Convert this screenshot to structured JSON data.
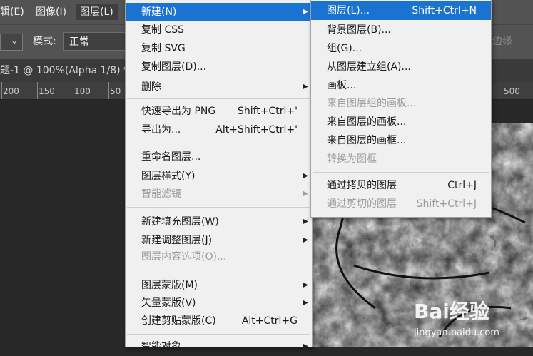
{
  "menubar": {
    "items": [
      "辑(E)",
      "图像(I)",
      "图层(L)"
    ]
  },
  "options": {
    "mode_label": "模式:",
    "mode_value": "正常",
    "edge_label": "边缘"
  },
  "doc_tab": {
    "title": "题-1 @ 100%(Alpha 1/8) *"
  },
  "ruler": {
    "ticks": [
      "200",
      "150",
      "100",
      "50",
      "500"
    ]
  },
  "layer_menu": {
    "items": [
      {
        "label": "新建(N)",
        "shortcut": "",
        "submenu": true,
        "disabled": false,
        "highlight": true
      },
      {
        "label": "复制 CSS",
        "shortcut": "",
        "submenu": false,
        "disabled": false
      },
      {
        "label": "复制 SVG",
        "shortcut": "",
        "submenu": false,
        "disabled": false
      },
      {
        "label": "复制图层(D)...",
        "shortcut": "",
        "submenu": false,
        "disabled": false
      },
      {
        "label": "删除",
        "shortcut": "",
        "submenu": true,
        "disabled": false
      },
      {
        "label": "快速导出为 PNG",
        "shortcut": "Shift+Ctrl+'",
        "submenu": false,
        "disabled": false
      },
      {
        "label": "导出为...",
        "shortcut": "Alt+Shift+Ctrl+'",
        "submenu": false,
        "disabled": false
      },
      {
        "label": "重命名图层...",
        "shortcut": "",
        "submenu": false,
        "disabled": false
      },
      {
        "label": "图层样式(Y)",
        "shortcut": "",
        "submenu": true,
        "disabled": false
      },
      {
        "label": "智能滤镜",
        "shortcut": "",
        "submenu": true,
        "disabled": true
      },
      {
        "label": "新建填充图层(W)",
        "shortcut": "",
        "submenu": true,
        "disabled": false
      },
      {
        "label": "新建调整图层(J)",
        "shortcut": "",
        "submenu": true,
        "disabled": false
      },
      {
        "label": "图层内容选项(O)...",
        "shortcut": "",
        "submenu": false,
        "disabled": true
      },
      {
        "label": "图层蒙版(M)",
        "shortcut": "",
        "submenu": true,
        "disabled": false
      },
      {
        "label": "矢量蒙版(V)",
        "shortcut": "",
        "submenu": true,
        "disabled": false
      },
      {
        "label": "创建剪贴蒙版(C)",
        "shortcut": "Alt+Ctrl+G",
        "submenu": false,
        "disabled": false
      },
      {
        "label": "智能对象",
        "shortcut": "",
        "submenu": true,
        "disabled": false
      }
    ]
  },
  "new_submenu": {
    "items": [
      {
        "label": "图层(L)...",
        "shortcut": "Shift+Ctrl+N",
        "disabled": false,
        "highlight": true
      },
      {
        "label": "背景图层(B)...",
        "shortcut": "",
        "disabled": false
      },
      {
        "label": "组(G)...",
        "shortcut": "",
        "disabled": false
      },
      {
        "label": "从图层建立组(A)...",
        "shortcut": "",
        "disabled": false
      },
      {
        "label": "画板...",
        "shortcut": "",
        "disabled": false
      },
      {
        "label": "来自图层组的画板...",
        "shortcut": "",
        "disabled": true
      },
      {
        "label": "来自图层的画板...",
        "shortcut": "",
        "disabled": false
      },
      {
        "label": "来自图层的画框...",
        "shortcut": "",
        "disabled": false
      },
      {
        "label": "转换为图框",
        "shortcut": "",
        "disabled": true
      },
      {
        "label": "通过拷贝的图层",
        "shortcut": "Ctrl+J",
        "disabled": false
      },
      {
        "label": "通过剪切的图层",
        "shortcut": "Shift+Ctrl+J",
        "disabled": true
      }
    ]
  },
  "watermark": {
    "logo": "Bai经验",
    "url": "jingyan.baidu.com"
  },
  "colors": {
    "highlight": "#1b73d1",
    "menu_bg": "#f0f0f0",
    "chrome": "#535353",
    "disabled_text": "#9c9c9c"
  }
}
